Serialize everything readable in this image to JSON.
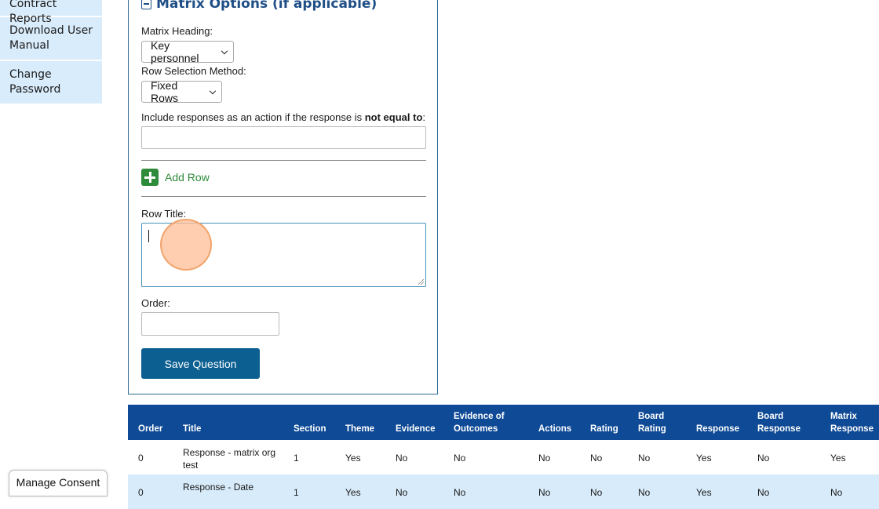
{
  "sidebar": {
    "items": [
      {
        "label": "Contract Reports"
      },
      {
        "label": "Download User Manual"
      },
      {
        "label": "Change Password"
      }
    ]
  },
  "matrix": {
    "heading": "Matrix Options (if applicable)",
    "matrix_heading_label": "Matrix Heading:",
    "matrix_heading_value": "Key personnel",
    "row_selection_label": "Row Selection Method:",
    "row_selection_value": "Fixed Rows",
    "include_prefix": "Include responses as an action if the response is ",
    "include_bold": "not equal to",
    "include_suffix": ":",
    "add_row_label": "Add Row",
    "row_title_label": "Row Title:",
    "order_label": "Order:",
    "save_label": "Save Question"
  },
  "table": {
    "headers": [
      "Order",
      "Title",
      "Section",
      "Theme",
      "Evidence",
      "Evidence of Outcomes",
      "Actions",
      "Rating",
      "Board Rating",
      "Response",
      "Board Response",
      "Matrix Response"
    ],
    "rows": [
      [
        "0",
        "Response - matrix org test",
        "1",
        "Yes",
        "No",
        "No",
        "No",
        "No",
        "No",
        "Yes",
        "No",
        "Yes"
      ],
      [
        "0",
        "Response - Date",
        "1",
        "Yes",
        "No",
        "No",
        "No",
        "No",
        "No",
        "Yes",
        "No",
        "No"
      ]
    ]
  },
  "consent": {
    "label": "Manage Consent"
  },
  "colors": {
    "accent": "#0b5f91",
    "table_header": "#0f4a96",
    "add_green": "#2e8b3a",
    "sidebar_bg": "#d9ecfb"
  }
}
